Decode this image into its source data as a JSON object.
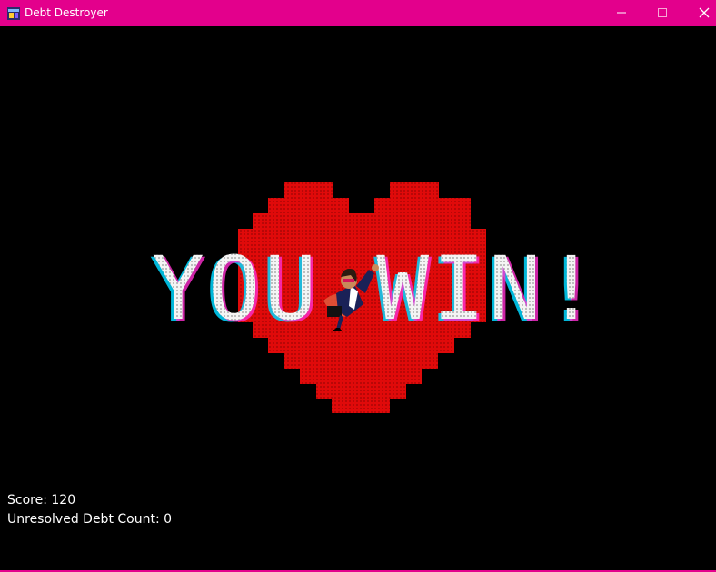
{
  "window": {
    "title": "Debt Destroyer",
    "accent_color": "#e3008c"
  },
  "icons": {
    "app": "game-app-icon",
    "minimize": "minimize-icon",
    "maximize": "maximize-icon",
    "close": "close-icon"
  },
  "game": {
    "banner_text": "YOU WIN!",
    "heart_color": "#e00a0a",
    "background_color": "#000000"
  },
  "hud": {
    "score_label": "Score: 120",
    "debt_label": "Unresolved Debt Count: 0"
  }
}
